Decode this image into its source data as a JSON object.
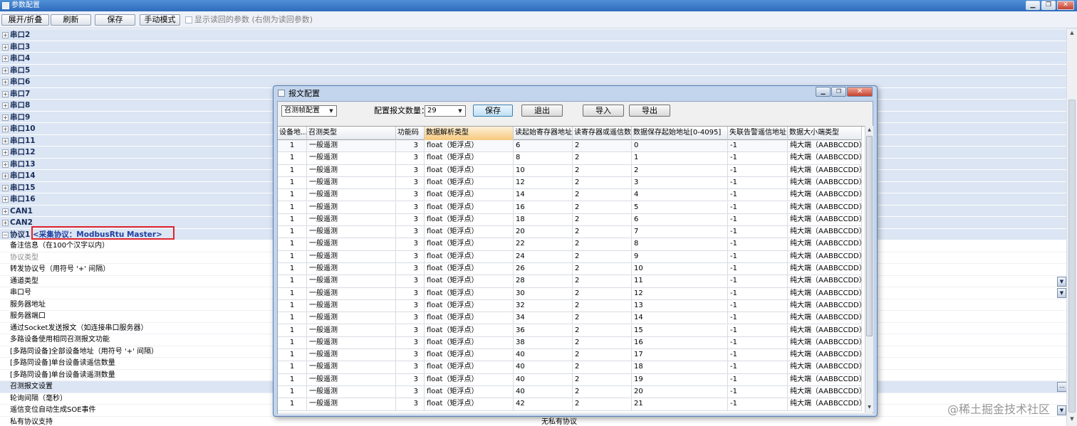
{
  "window": {
    "title": "参数配置"
  },
  "toolbar": {
    "expand_label": "展开/折叠",
    "refresh_label": "刷新",
    "save_label": "保存",
    "manual_label": "手动模式",
    "show_read_label": "显示读回的参数 (右侧为读回参数)"
  },
  "tree": {
    "groups": [
      "串口2",
      "串口3",
      "串口4",
      "串口5",
      "串口6",
      "串口7",
      "串口8",
      "串口9",
      "串口10",
      "串口11",
      "串口12",
      "串口13",
      "串口14",
      "串口15",
      "串口16",
      "CAN1",
      "CAN2"
    ],
    "protocol": {
      "label": "协议1",
      "subtitle": "<采集协议：ModbusRtu Master>"
    },
    "properties": [
      "备注信息（在100个汉字以内）",
      "协议类型",
      "转发协议号（用符号 '+' 间隔）",
      "通道类型",
      "串口号",
      "服务器地址",
      "服务器端口",
      "通过Socket发送报文（如连接串口服务器）",
      "多路设备使用相同召测报文功能",
      "[多路同设备]全部设备地址（用符号 '+' 间隔）",
      "[多路同设备]单台设备读遥信数量",
      "[多路同设备]单台设备读遥测数量",
      "召测报文设置",
      "轮询间隔（毫秒）",
      "遥信变位自动生成SOE事件",
      "私有协议支持"
    ],
    "private_value": "无私有协议"
  },
  "dialog": {
    "title": "报文配置",
    "mode_select": "召测帧配置",
    "count_label": "配置报文数量：",
    "count_value": "29",
    "save_label": "保存",
    "exit_label": "退出",
    "import_label": "导入",
    "export_label": "导出",
    "columns": [
      "设备地...",
      "召测类型",
      "功能码",
      "数据解析类型",
      "读起始寄存器地址",
      "读寄存器或遥信数",
      "数据保存起始地址[0-4095]",
      "失联告警遥信地址",
      "数据大小端类型"
    ],
    "rows": [
      [
        "1",
        "一般遥测",
        "3",
        "float（矩浮点）",
        "6",
        "2",
        "0",
        "-1",
        "纯大端（AABBCCDD）"
      ],
      [
        "1",
        "一般遥测",
        "3",
        "float（矩浮点）",
        "8",
        "2",
        "1",
        "-1",
        "纯大端（AABBCCDD）"
      ],
      [
        "1",
        "一般遥测",
        "3",
        "float（矩浮点）",
        "10",
        "2",
        "2",
        "-1",
        "纯大端（AABBCCDD）"
      ],
      [
        "1",
        "一般遥测",
        "3",
        "float（矩浮点）",
        "12",
        "2",
        "3",
        "-1",
        "纯大端（AABBCCDD）"
      ],
      [
        "1",
        "一般遥测",
        "3",
        "float（矩浮点）",
        "14",
        "2",
        "4",
        "-1",
        "纯大端（AABBCCDD）"
      ],
      [
        "1",
        "一般遥测",
        "3",
        "float（矩浮点）",
        "16",
        "2",
        "5",
        "-1",
        "纯大端（AABBCCDD）"
      ],
      [
        "1",
        "一般遥测",
        "3",
        "float（矩浮点）",
        "18",
        "2",
        "6",
        "-1",
        "纯大端（AABBCCDD）"
      ],
      [
        "1",
        "一般遥测",
        "3",
        "float（矩浮点）",
        "20",
        "2",
        "7",
        "-1",
        "纯大端（AABBCCDD）"
      ],
      [
        "1",
        "一般遥测",
        "3",
        "float（矩浮点）",
        "22",
        "2",
        "8",
        "-1",
        "纯大端（AABBCCDD）"
      ],
      [
        "1",
        "一般遥测",
        "3",
        "float（矩浮点）",
        "24",
        "2",
        "9",
        "-1",
        "纯大端（AABBCCDD）"
      ],
      [
        "1",
        "一般遥测",
        "3",
        "float（矩浮点）",
        "26",
        "2",
        "10",
        "-1",
        "纯大端（AABBCCDD）"
      ],
      [
        "1",
        "一般遥测",
        "3",
        "float（矩浮点）",
        "28",
        "2",
        "11",
        "-1",
        "纯大端（AABBCCDD）"
      ],
      [
        "1",
        "一般遥测",
        "3",
        "float（矩浮点）",
        "30",
        "2",
        "12",
        "-1",
        "纯大端（AABBCCDD）"
      ],
      [
        "1",
        "一般遥测",
        "3",
        "float（矩浮点）",
        "32",
        "2",
        "13",
        "-1",
        "纯大端（AABBCCDD）"
      ],
      [
        "1",
        "一般遥测",
        "3",
        "float（矩浮点）",
        "34",
        "2",
        "14",
        "-1",
        "纯大端（AABBCCDD）"
      ],
      [
        "1",
        "一般遥测",
        "3",
        "float（矩浮点）",
        "36",
        "2",
        "15",
        "-1",
        "纯大端（AABBCCDD）"
      ],
      [
        "1",
        "一般遥测",
        "3",
        "float（矩浮点）",
        "38",
        "2",
        "16",
        "-1",
        "纯大端（AABBCCDD）"
      ],
      [
        "1",
        "一般遥测",
        "3",
        "float（矩浮点）",
        "40",
        "2",
        "17",
        "-1",
        "纯大端（AABBCCDD）"
      ],
      [
        "1",
        "一般遥测",
        "3",
        "float（矩浮点）",
        "40",
        "2",
        "18",
        "-1",
        "纯大端（AABBCCDD）"
      ],
      [
        "1",
        "一般遥测",
        "3",
        "float（矩浮点）",
        "40",
        "2",
        "19",
        "-1",
        "纯大端（AABBCCDD）"
      ],
      [
        "1",
        "一般遥测",
        "3",
        "float（矩浮点）",
        "40",
        "2",
        "20",
        "-1",
        "纯大端（AABBCCDD）"
      ],
      [
        "1",
        "一般遥测",
        "3",
        "float（矩浮点）",
        "42",
        "2",
        "21",
        "-1",
        "纯大端（AABBCCDD）"
      ]
    ]
  },
  "watermark": "@稀土掘金技术社区"
}
